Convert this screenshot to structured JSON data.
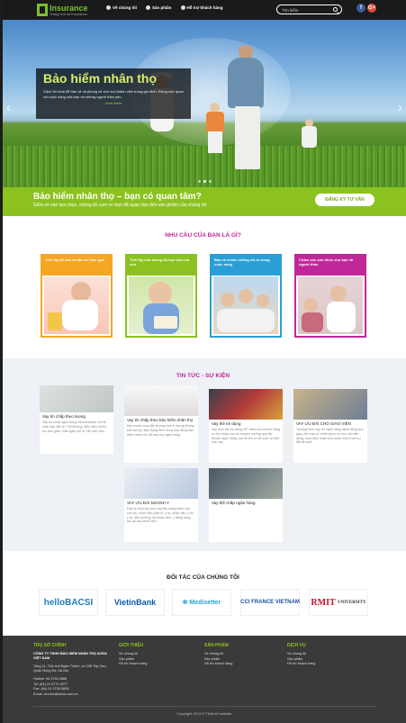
{
  "header": {
    "logo_name": "Insurance",
    "logo_tagline": "Trang chủ về Insurance",
    "nav": [
      {
        "label": "Về chúng tôi",
        "icon": "info-icon"
      },
      {
        "label": "Sản phẩm",
        "icon": "box-icon"
      },
      {
        "label": "Hỗ trợ khách hàng",
        "icon": "support-icon"
      }
    ],
    "search_placeholder": "Tìm kiếm",
    "social": [
      {
        "name": "facebook-icon",
        "glyph": "f"
      },
      {
        "name": "google-plus-icon",
        "glyph": "G+"
      }
    ]
  },
  "hero": {
    "title": "Bảo hiểm nhân thọ",
    "description": "Cách tốt nhất để bảo vệ và phòng vệ cho mọi thành viên trong gia đình. Đừng chờ quan với cuộc sống của bạn và những người thân yêu.",
    "more": "Xem thêm",
    "prev": "‹",
    "next": "›",
    "slide_count": 3,
    "active_slide": 2
  },
  "cta": {
    "title": "Bảo hiểm nhân thọ – bạn có quan tâm?",
    "subtitle": "Giữa vô vàn lựa chọn, chúng tôi cam on bạn đã quan tâm đến sản phẩm của chúng tôi.",
    "button": "ĐĂNG KÝ TƯ VẤN"
  },
  "needs": {
    "title": "NHU CẦU CỦA BẠN LÀ GÌ?",
    "cards": [
      {
        "label": "Tích lũy tài sản và đầu tư hiệu quả"
      },
      {
        "label": "Tích lũy cho tương lai học vấn của con"
      },
      {
        "label": "Bảo vệ trước những rủi ro trong cuộc sống"
      },
      {
        "label": "Chăm sóc sức khỏe cho bạn và người thân"
      }
    ]
  },
  "news": {
    "title": "TIN TỨC - SỰ KIỆN",
    "items": [
      {
        "title": "Vay tín chấp theo lương",
        "excerpt": "Vay tín chấp ngân hàng Vietcombank, với lãi suất hấp dẫn từ 7.8%/tháng, điều kiện và thủ tục đơn giản. Giải ngân chỉ từ 24h làm việc."
      },
      {
        "title": "Vay tín chấp theo bảo hiểm nhân thọ",
        "excerpt": "Bạn muốn mua đất đương nhà ở nhưng không biết làm gì. Bạn đang định dùng hợp đồng bảo hiểm nhân thọ để vay vốn ngân hàng."
      },
      {
        "title": "Vay thẻ tín dụng",
        "excerpt": "Vay theo thẻ tín dụng VIP dành cho khách hàng có thu nhập cao và chuyên hưởng quy tắc khoản ngân hàng, lựa tối tên về lãi suất và thời hạn vay."
      },
      {
        "title": "VAY ƯU ĐÃI CHO GIÁO VIÊN",
        "excerpt": "Trường trình vay tín ngân hàng dành riêng cho giáo viên bậc từ nhiên phục vụ nhu cầu tiêu dùng, mua sắm hoặc sửa chữa nhà ở với ưu đãi lãi suất."
      },
      {
        "title": "VAY ƯU ĐÃI NGÀNH Y",
        "excerpt": "Đây là chương trình vay tiêu dùng dành cho cán bộ, nhân viên (bác sĩ, y tá, nhân viên, y tế, y tá, điều dưỡng, kỹ thuật viên...) đang công tác tại các bệnh viện."
      },
      {
        "title": "Vay thế chấp ngân hàng",
        "excerpt": ""
      }
    ]
  },
  "partners": {
    "title": "ĐỐI TÁC CỦA CHÚNG TÔI",
    "items": [
      {
        "name": "helloBACSI"
      },
      {
        "name": "VietinBank"
      },
      {
        "name": "✻ Medisetter"
      },
      {
        "name": "CCI FRANCE VIETNAM"
      },
      {
        "name_main": "RMIT",
        "name_sub": "UNIVERSITY"
      }
    ]
  },
  "footer": {
    "office": {
      "heading": "Trụ sở chính",
      "company": "CÔNG TY TNHH BẢO HIỂM NHÂN THỌ AVIVA VIỆT NAM",
      "address": "Tầng 11, Thủ nhà Ngân Thành, số 208 Tây Sơn, Quận Đống Đa, Hà Nội",
      "hotline": "Hotline: 04.3734.0888",
      "tel": "Tel: (84) 24 3771 0077",
      "fax": "Fax: (84) 24 3736 8808",
      "email": "Email: service@aviva.com.vn"
    },
    "cols": [
      {
        "heading": "Giới thiệu",
        "links": [
          "Về chúng tôi",
          "Sản phẩm",
          "Hỗ trợ khách hàng"
        ]
      },
      {
        "heading": "Sản phẩm",
        "links": [
          "Về chúng tôi",
          "Sản phẩm",
          "Hỗ trợ khách hàng"
        ]
      },
      {
        "heading": "Dịch vụ",
        "links": [
          "Về chúng tôi",
          "Sản phẩm",
          "Hỗ trợ khách hàng"
        ]
      }
    ],
    "copyright": "Copyright 2019 © Thiết kế website"
  },
  "colors": {
    "accent_green": "#8bc21f",
    "accent_magenta": "#c0289a",
    "header_bg": "#1a1a1a",
    "footer_bg": "#3a3a3a"
  }
}
